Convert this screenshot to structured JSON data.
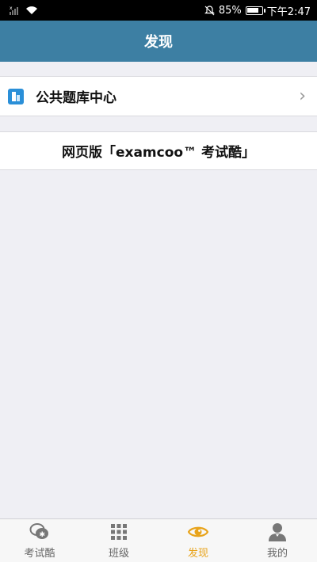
{
  "status_bar": {
    "battery": "85%",
    "time": "下午2:47",
    "battery_level": 0.85
  },
  "nav": {
    "title": "发现"
  },
  "cells": {
    "question_bank": {
      "label": "公共题库中心",
      "icon": "question-bank-icon"
    },
    "web_version": {
      "label": "网页版「examcoo™ 考试酷」"
    }
  },
  "tabs": [
    {
      "label": "考试酷",
      "icon": "chat-bubbles-icon",
      "active": false
    },
    {
      "label": "班级",
      "icon": "grid-icon",
      "active": false
    },
    {
      "label": "发现",
      "icon": "eye-icon",
      "active": true
    },
    {
      "label": "我的",
      "icon": "person-icon",
      "active": false
    }
  ],
  "colors": {
    "nav_bg": "#3d7fa3",
    "active_tab": "#e8a31a",
    "background": "#efeff4"
  }
}
